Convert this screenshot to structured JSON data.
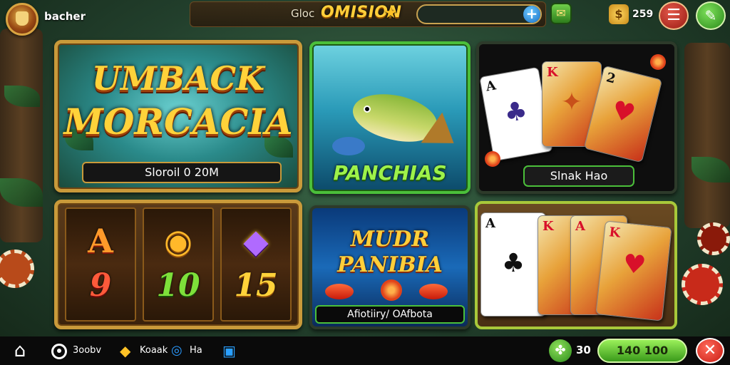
{
  "header": {
    "username": "bacher",
    "glob_label": "Gloc",
    "mission_title": "OMISION",
    "search_placeholder": "",
    "coin_count": "259"
  },
  "tiles": {
    "cashback": {
      "title_line1": "UMBACK",
      "title_line2": "MORCACIA",
      "caption": "Sloroil 0 20M"
    },
    "fish": {
      "title": "PANCHIAS"
    },
    "cards1": {
      "caption": "Slnak Hao",
      "card_ranks": [
        "A",
        "K",
        "2"
      ]
    },
    "slots": {
      "symbols": [
        "A",
        "◉",
        "◆"
      ],
      "numbers": [
        "9",
        "10",
        "15"
      ]
    },
    "mudr": {
      "title_line1": "MUDR",
      "title_line2": "PANIBIA",
      "caption": "Afiotiiry/ OAfbota"
    },
    "cards2": {
      "card_ranks": [
        "A",
        "K",
        "A",
        "K"
      ]
    }
  },
  "bottom_nav": {
    "item1_label": "3oobv",
    "item2_label": "Koaak",
    "item3_label": "Ha",
    "clover_count": "30",
    "balance": "140 100"
  },
  "colors": {
    "accent_gold": "#ffcf3a",
    "accent_green": "#4bbf3a",
    "close_red": "#c81a12"
  },
  "icons": [
    "avatar-icon",
    "star-icon",
    "plus-icon",
    "gift-icon",
    "coin-icon",
    "menu-icon",
    "edit-icon",
    "home-icon",
    "target-icon",
    "gem-icon",
    "ring-icon",
    "bag-icon",
    "clover-icon",
    "close-icon"
  ]
}
